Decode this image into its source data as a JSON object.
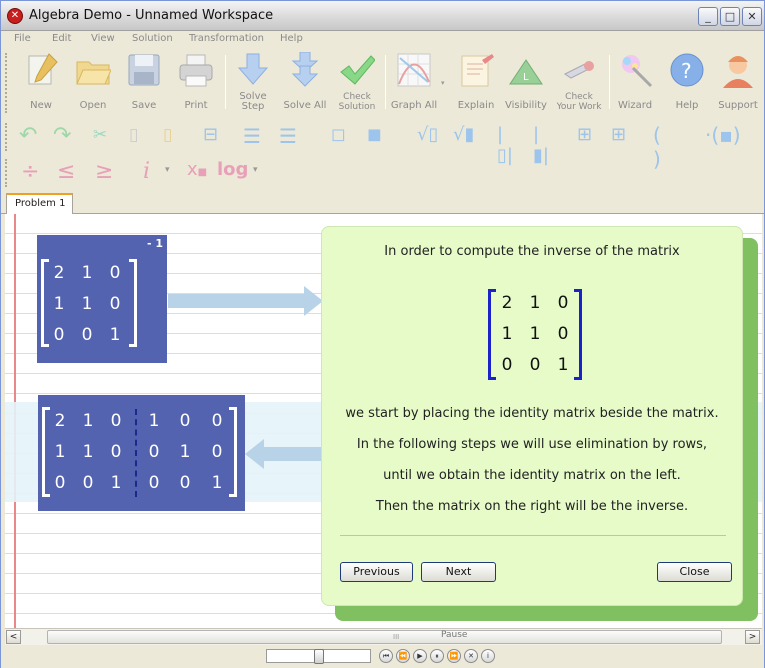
{
  "window": {
    "title": "Algebra Demo - Unnamed Workspace",
    "app_icon": "algebra-app-icon",
    "controls": {
      "minimize": "_",
      "maximize": "□",
      "close": "✕"
    }
  },
  "menu": [
    "File",
    "Edit",
    "View",
    "Solution",
    "Transformation",
    "Help"
  ],
  "toolbar": {
    "buttons": [
      {
        "label": "New",
        "icon": "new-document-icon"
      },
      {
        "label": "Open",
        "icon": "open-folder-icon"
      },
      {
        "label": "Save",
        "icon": "save-disk-icon"
      },
      {
        "label": "Print",
        "icon": "printer-icon"
      },
      {
        "label": "Solve\nStep",
        "icon": "down-arrow-icon"
      },
      {
        "label": "Solve All",
        "icon": "double-down-arrow-icon"
      },
      {
        "label": "Check\nSolution",
        "icon": "green-check-icon"
      },
      {
        "label": "Graph All",
        "icon": "graph-icon"
      },
      {
        "label": "Explain",
        "icon": "explain-notepad-icon"
      },
      {
        "label": "Visibility",
        "icon": "visibility-triangle-icon"
      },
      {
        "label": "Check\nYour Work",
        "icon": "wrench-check-icon"
      },
      {
        "label": "Wizard",
        "icon": "wizard-wand-icon"
      },
      {
        "label": "Help",
        "icon": "help-question-icon"
      },
      {
        "label": "Support",
        "icon": "support-person-icon"
      }
    ],
    "row2_icons": [
      "undo-icon",
      "redo-icon",
      "cut-icon",
      "copy-icon",
      "paste-icon",
      "fraction-icon",
      "vertical-fraction-icon",
      "divide-line-icon",
      "superscript-icon",
      "subscript-icon",
      "sqrt-icon",
      "nth-root-icon",
      "abs-value-icon",
      "matrix-icon",
      "matrix-grid-icon",
      "parentheses-icon",
      "parentheses-dot-icon"
    ],
    "row3": {
      "divide": "÷",
      "le": "≤",
      "ge": "≥",
      "imaginary": "i",
      "subscript_x": "x",
      "log": "log"
    }
  },
  "tabs": [
    "Problem 1"
  ],
  "workspace": {
    "matrix": [
      [
        "2",
        "1",
        "0"
      ],
      [
        "1",
        "1",
        "0"
      ],
      [
        "0",
        "0",
        "1"
      ]
    ],
    "inverse_exponent": "- 1",
    "augmented": [
      [
        "2",
        "1",
        "0",
        "1",
        "0",
        "0"
      ],
      [
        "1",
        "1",
        "0",
        "0",
        "1",
        "0"
      ],
      [
        "0",
        "0",
        "1",
        "0",
        "0",
        "1"
      ]
    ]
  },
  "explain_dialog": {
    "intro": "In order to compute the inverse of the matrix",
    "matrix": [
      [
        "2",
        "1",
        "0"
      ],
      [
        "1",
        "1",
        "0"
      ],
      [
        "0",
        "0",
        "1"
      ]
    ],
    "lines": [
      "we start by placing the identity matrix beside  the matrix.",
      "In the following steps we will use elimination by rows,",
      "until we obtain the identity matrix on the left.",
      "Then the matrix on the right will be the inverse."
    ],
    "buttons": {
      "previous": "Previous",
      "next": "Next",
      "close": "Close"
    }
  },
  "statusbar": {
    "pause_label": "Pause",
    "scroll_left": "<",
    "scroll_right": ">",
    "grip": "III"
  },
  "player": {
    "position": 0.5
  }
}
